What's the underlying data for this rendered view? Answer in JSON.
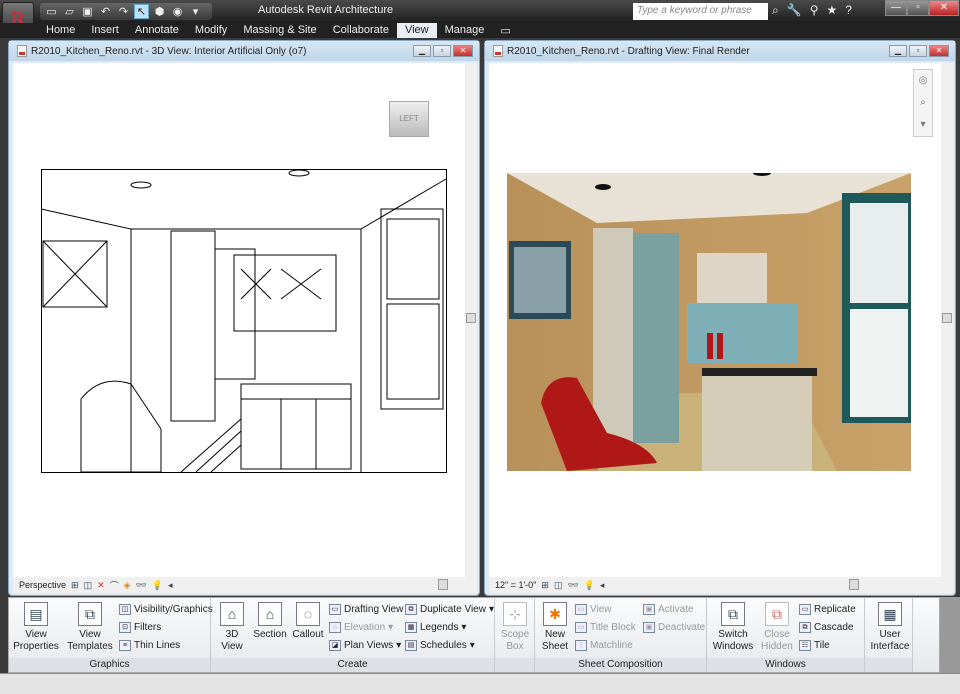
{
  "app": {
    "title": "Autodesk Revit Architecture",
    "logo": "R",
    "search_placeholder": "Type a keyword or phrase"
  },
  "qat": [
    "new-icon",
    "open-icon",
    "save-icon",
    "undo-icon",
    "redo-icon",
    "select-icon",
    "3d-icon",
    "sync-icon",
    "dropdown-icon"
  ],
  "tabs": [
    "Home",
    "Insert",
    "Annotate",
    "Modify",
    "Massing & Site",
    "Collaborate",
    "View",
    "Manage"
  ],
  "active_tab": "View",
  "left_window": {
    "title": "R2010_Kitchen_Reno.rvt - 3D View: Interior Artificial Only (o7)",
    "viewcube": "LEFT",
    "status": "Perspective"
  },
  "right_window": {
    "title": "R2010_Kitchen_Reno.rvt - Drafting View: Final Render",
    "status": "12\" = 1'-0\""
  },
  "ribbon": {
    "graphics": {
      "label": "Graphics",
      "view_properties": [
        "View",
        "Properties"
      ],
      "view_templates": [
        "View",
        "Templates"
      ],
      "visibility": "Visibility/Graphics",
      "filters": "Filters",
      "thin_lines": "Thin Lines"
    },
    "create": {
      "label": "Create",
      "view3d": [
        "3D",
        "View"
      ],
      "section": "Section",
      "callout": "Callout",
      "drafting_view": "Drafting View",
      "elevation": "Elevation",
      "plan_views": "Plan Views",
      "duplicate_view": "Duplicate View",
      "legends": "Legends",
      "schedules": "Schedules",
      "scope_box": [
        "Scope",
        "Box"
      ]
    },
    "sheet": {
      "label": "Sheet Composition",
      "new_sheet": [
        "New",
        "Sheet"
      ],
      "view": "View",
      "title_block": "Title Block",
      "matchline": "Matchline",
      "activate": "Activate",
      "deactivate": "Deactivate"
    },
    "windows": {
      "label": "Windows",
      "switch": [
        "Switch",
        "Windows"
      ],
      "close_hidden": [
        "Close",
        "Hidden"
      ],
      "replicate": "Replicate",
      "cascade": "Cascade",
      "tile": "Tile",
      "user_interface": [
        "User",
        "Interface"
      ]
    }
  }
}
